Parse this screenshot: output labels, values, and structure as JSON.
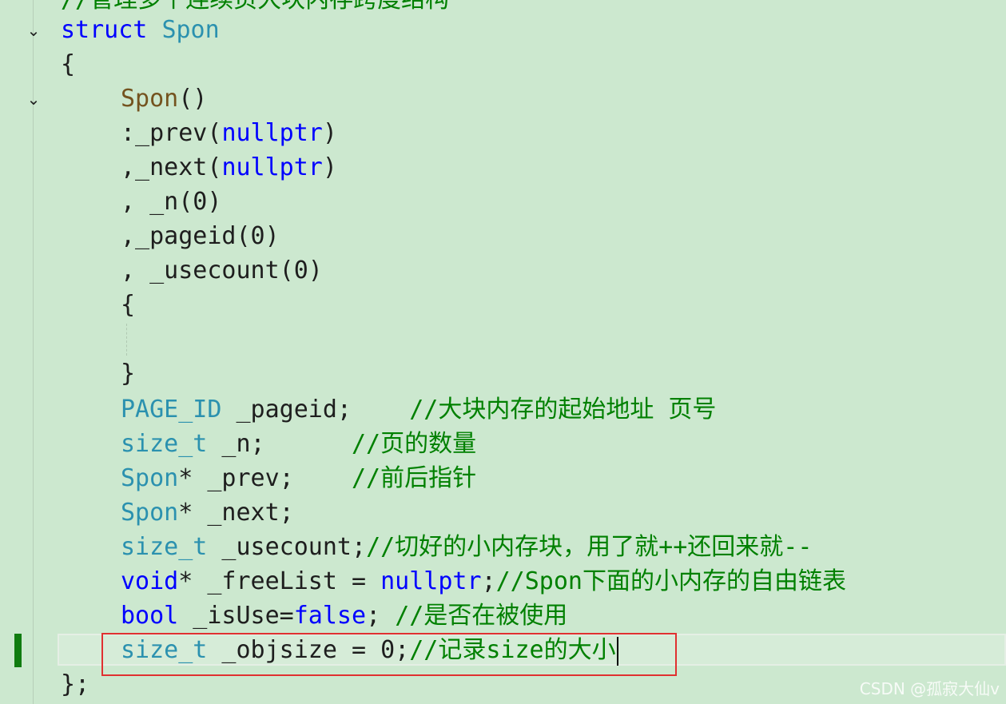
{
  "editor": {
    "top_comment": "//管理多个连续页大块内存跨度结构",
    "struct_kw": "struct",
    "struct_name": "Spon",
    "open_brace": "{",
    "ctor_name": "Spon",
    "ctor_parens": "()",
    "init1_pre": ":_prev(",
    "nullptr": "nullptr",
    "close_paren": ")",
    "init2_pre": ",_next(",
    "init3": ", _n(0)",
    "init4": ",_pageid(0)",
    "init5": ", _usecount(0)",
    "ctor_open": "{",
    "ctor_close": "}",
    "page_id_type": "PAGE_ID",
    "pageid_decl": " _pageid;    ",
    "pageid_comment": "//大块内存的起始地址 页号",
    "size_t": "size_t",
    "n_decl": " _n;      ",
    "n_comment": "//页的数量",
    "spon": "Spon",
    "prev_decl": "* _prev;    ",
    "prev_comment": "//前后指针",
    "next_decl": "* _next;",
    "usecount_decl": " _usecount;",
    "usecount_comment": "//切好的小内存块，用了就++还回来就--",
    "void_kw": "void",
    "freelist_decl": "* _freeList = ",
    "freelist_end": ";",
    "freelist_comment": "//Spon下面的小内存的自由链表",
    "bool_kw": "bool",
    "isuse_decl": " _isUse=",
    "false_kw": "false",
    "isuse_end": "; ",
    "isuse_comment": "//是否在被使用",
    "objsize_decl": " _objsize = 0;",
    "objsize_comment": "//记录size的大小",
    "close_struct": "};"
  },
  "icons": {
    "fold": "chevron-down-icon"
  },
  "colors": {
    "keyword": "#0000ff",
    "type": "#2b91af",
    "function": "#74531f",
    "comment": "#008000",
    "background": "#cce8cf",
    "highlight": "#e03030"
  },
  "watermark": "CSDN @孤寂大仙v"
}
